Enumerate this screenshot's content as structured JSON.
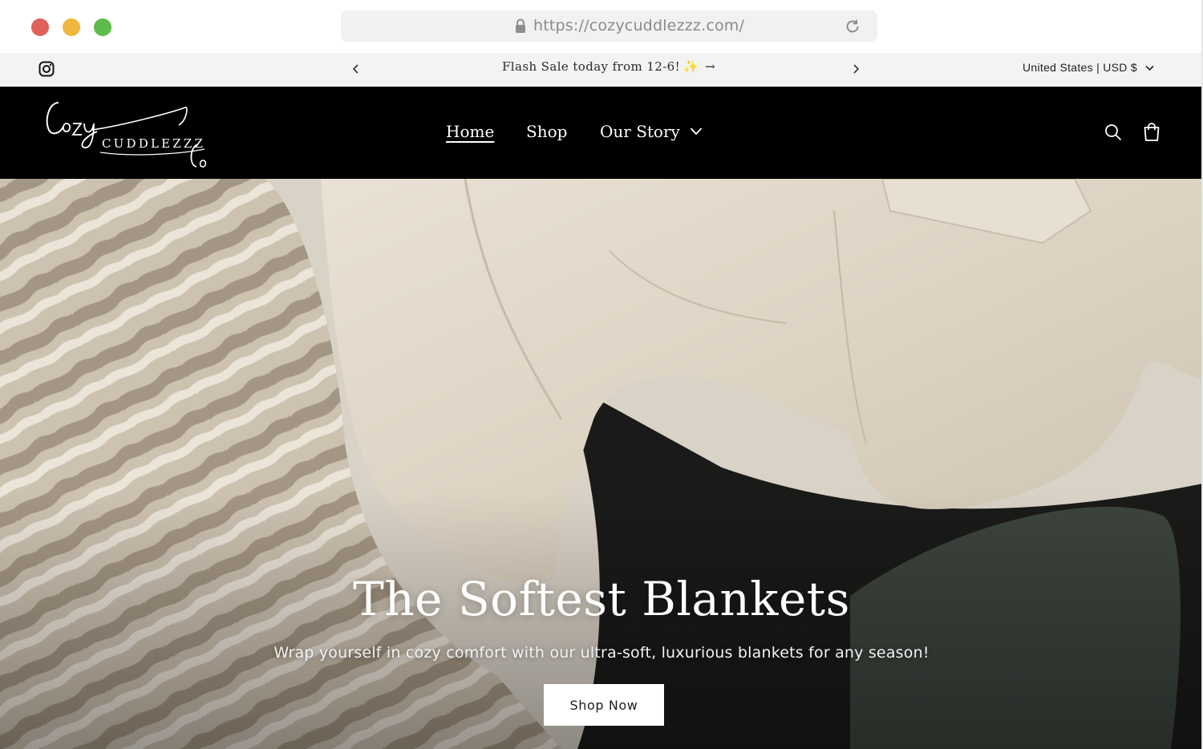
{
  "browser": {
    "url": "https://cozycuddlezzz.com/",
    "traffic_lights": {
      "close": "#e0605a",
      "minimize": "#efb73c",
      "zoom": "#5cbd48"
    },
    "icons": [
      "lock-icon",
      "reload-icon"
    ]
  },
  "announcement": {
    "message": "Flash Sale today from 12-6!",
    "emoji": "✨",
    "arrow": "→",
    "locale": "United States | USD $",
    "icons": [
      "instagram-icon",
      "chevron-left-icon",
      "chevron-right-icon",
      "chevron-down-icon"
    ]
  },
  "header": {
    "logo_text": "CUDDLEZZZ",
    "logo_script_top": "Cozy",
    "logo_script_bottom": "Co",
    "nav": [
      {
        "label": "Home",
        "active": true
      },
      {
        "label": "Shop",
        "active": false
      },
      {
        "label": "Our Story",
        "active": false,
        "has_dropdown": true
      }
    ],
    "icons": [
      "search-icon",
      "cart-icon"
    ]
  },
  "hero": {
    "title": "The Softest Blankets",
    "subtitle": "Wrap yourself in cozy comfort with our ultra-soft, luxurious blankets for any season!",
    "cta_label": "Shop Now"
  },
  "colors": {
    "header_bg": "#000000",
    "announcement_bg": "#f3f3f3",
    "hero_fabric": "#d8d0c4",
    "blanket_stripe": "#a89a86",
    "chair": "#3c443d"
  }
}
